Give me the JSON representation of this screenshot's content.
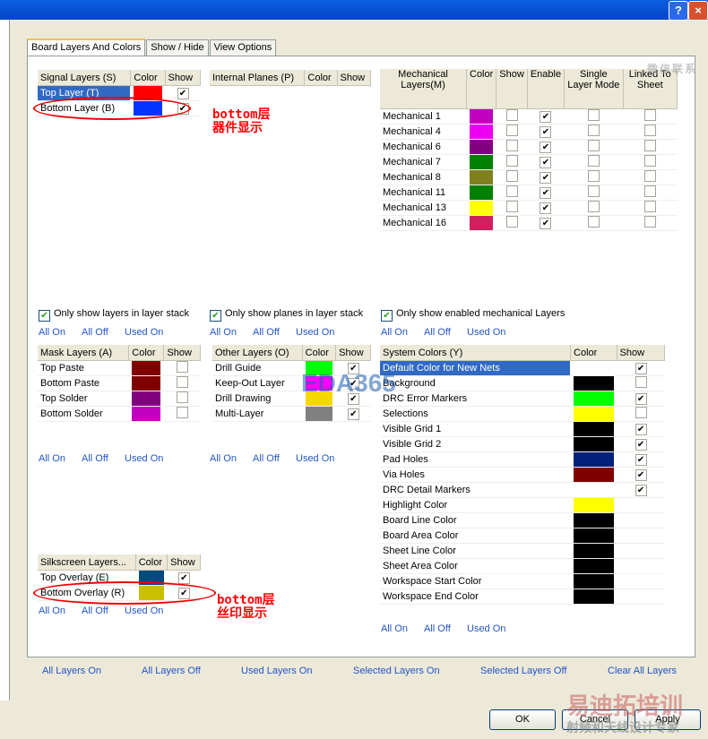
{
  "tabs": [
    "Board Layers And Colors",
    "Show / Hide",
    "View Options"
  ],
  "signal": {
    "headers": [
      "Signal Layers (S)",
      "Color",
      "Show"
    ],
    "rows": [
      {
        "name": "Top Layer (T)",
        "color": "#ff0000",
        "show": true,
        "selected": true
      },
      {
        "name": "Bottom Layer (B)",
        "color": "#0033ff",
        "show": true
      }
    ]
  },
  "planes": {
    "headers": [
      "Internal Planes (P)",
      "Color",
      "Show"
    ],
    "rows": []
  },
  "mech": {
    "headers": [
      "Mechanical Layers(M)",
      "Color",
      "Show",
      "Enable",
      "Single Layer Mode",
      "Linked To Sheet"
    ],
    "rows": [
      {
        "name": "Mechanical 1",
        "color": "#c000c0",
        "show": false,
        "enable": true
      },
      {
        "name": "Mechanical 4",
        "color": "#f000f0",
        "show": false,
        "enable": true
      },
      {
        "name": "Mechanical 6",
        "color": "#800080",
        "show": false,
        "enable": true
      },
      {
        "name": "Mechanical 7",
        "color": "#008000",
        "show": false,
        "enable": true
      },
      {
        "name": "Mechanical 8",
        "color": "#808020",
        "show": false,
        "enable": true
      },
      {
        "name": "Mechanical 11",
        "color": "#008000",
        "show": false,
        "enable": true
      },
      {
        "name": "Mechanical 13",
        "color": "#ffff00",
        "show": false,
        "enable": true
      },
      {
        "name": "Mechanical 16",
        "color": "#d02060",
        "show": false,
        "enable": true
      }
    ]
  },
  "options": {
    "only_layers": "Only show layers in layer stack",
    "only_planes": "Only show planes in layer stack",
    "only_mech": "Only show enabled mechanical Layers"
  },
  "links": {
    "all_on": "All On",
    "all_off": "All Off",
    "used_on": "Used On"
  },
  "mask": {
    "headers": [
      "Mask Layers (A)",
      "Color",
      "Show"
    ],
    "rows": [
      {
        "name": "Top Paste",
        "color": "#800000",
        "show": false
      },
      {
        "name": "Bottom Paste",
        "color": "#800000",
        "show": false
      },
      {
        "name": "Top Solder",
        "color": "#800080",
        "show": false
      },
      {
        "name": "Bottom Solder",
        "color": "#c000c0",
        "show": false
      }
    ]
  },
  "other": {
    "headers": [
      "Other Layers (O)",
      "Color",
      "Show"
    ],
    "rows": [
      {
        "name": "Drill Guide",
        "color": "#00ff00",
        "show": true
      },
      {
        "name": "Keep-Out Layer",
        "color": "#ff00ff",
        "show": true
      },
      {
        "name": "Drill Drawing",
        "color": "#f5d800",
        "show": true
      },
      {
        "name": "Multi-Layer",
        "color": "#808080",
        "show": true
      }
    ]
  },
  "system": {
    "headers": [
      "System Colors (Y)",
      "Color",
      "Show"
    ],
    "rows": [
      {
        "name": "Default Color for New Nets",
        "color": "#ffffff",
        "show": true,
        "selected": true
      },
      {
        "name": "Background",
        "color": "#000000",
        "show": false
      },
      {
        "name": "DRC Error Markers",
        "color": "#00ff00",
        "show": true
      },
      {
        "name": "Selections",
        "color": "#ffff00",
        "show": false
      },
      {
        "name": "Visible Grid 1",
        "color": "#000000",
        "show": true
      },
      {
        "name": "Visible Grid 2",
        "color": "#000000",
        "show": true
      },
      {
        "name": "Pad Holes",
        "color": "#00207c",
        "show": true
      },
      {
        "name": "Via Holes",
        "color": "#800000",
        "show": true
      },
      {
        "name": "DRC Detail Markers",
        "color": "#ffffff",
        "show": true
      },
      {
        "name": "Highlight Color",
        "color": "#ffff00",
        "show": null
      },
      {
        "name": "Board Line Color",
        "color": "#000000",
        "show": null
      },
      {
        "name": "Board Area Color",
        "color": "#000000",
        "show": null
      },
      {
        "name": "Sheet Line Color",
        "color": "#000000",
        "show": null
      },
      {
        "name": "Sheet Area Color",
        "color": "#000000",
        "show": null
      },
      {
        "name": "Workspace Start Color",
        "color": "#000000",
        "show": null
      },
      {
        "name": "Workspace End Color",
        "color": "#000000",
        "show": null
      }
    ]
  },
  "silk": {
    "headers": [
      "Silkscreen Layers...",
      "Color",
      "Show"
    ],
    "rows": [
      {
        "name": "Top Overlay (E)",
        "color": "#004a80",
        "show": true
      },
      {
        "name": "Bottom Overlay (R)",
        "color": "#c8c000",
        "show": true
      }
    ]
  },
  "bottom_links": [
    "All Layers On",
    "All Layers Off",
    "Used Layers On",
    "Selected Layers On",
    "Selected Layers Off",
    "Clear All Layers"
  ],
  "buttons": {
    "ok": "OK",
    "cancel": "Cancel",
    "apply": "Apply"
  },
  "annotations": {
    "a1": "bottom层",
    "a2": "器件显示",
    "b1": "bottom层",
    "b2": "丝印显示"
  },
  "watermarks": {
    "eda": "EDA365",
    "wechat": "微信联系",
    "brand": "易迪拓培训",
    "tagline": "射频和天线设计专家"
  }
}
